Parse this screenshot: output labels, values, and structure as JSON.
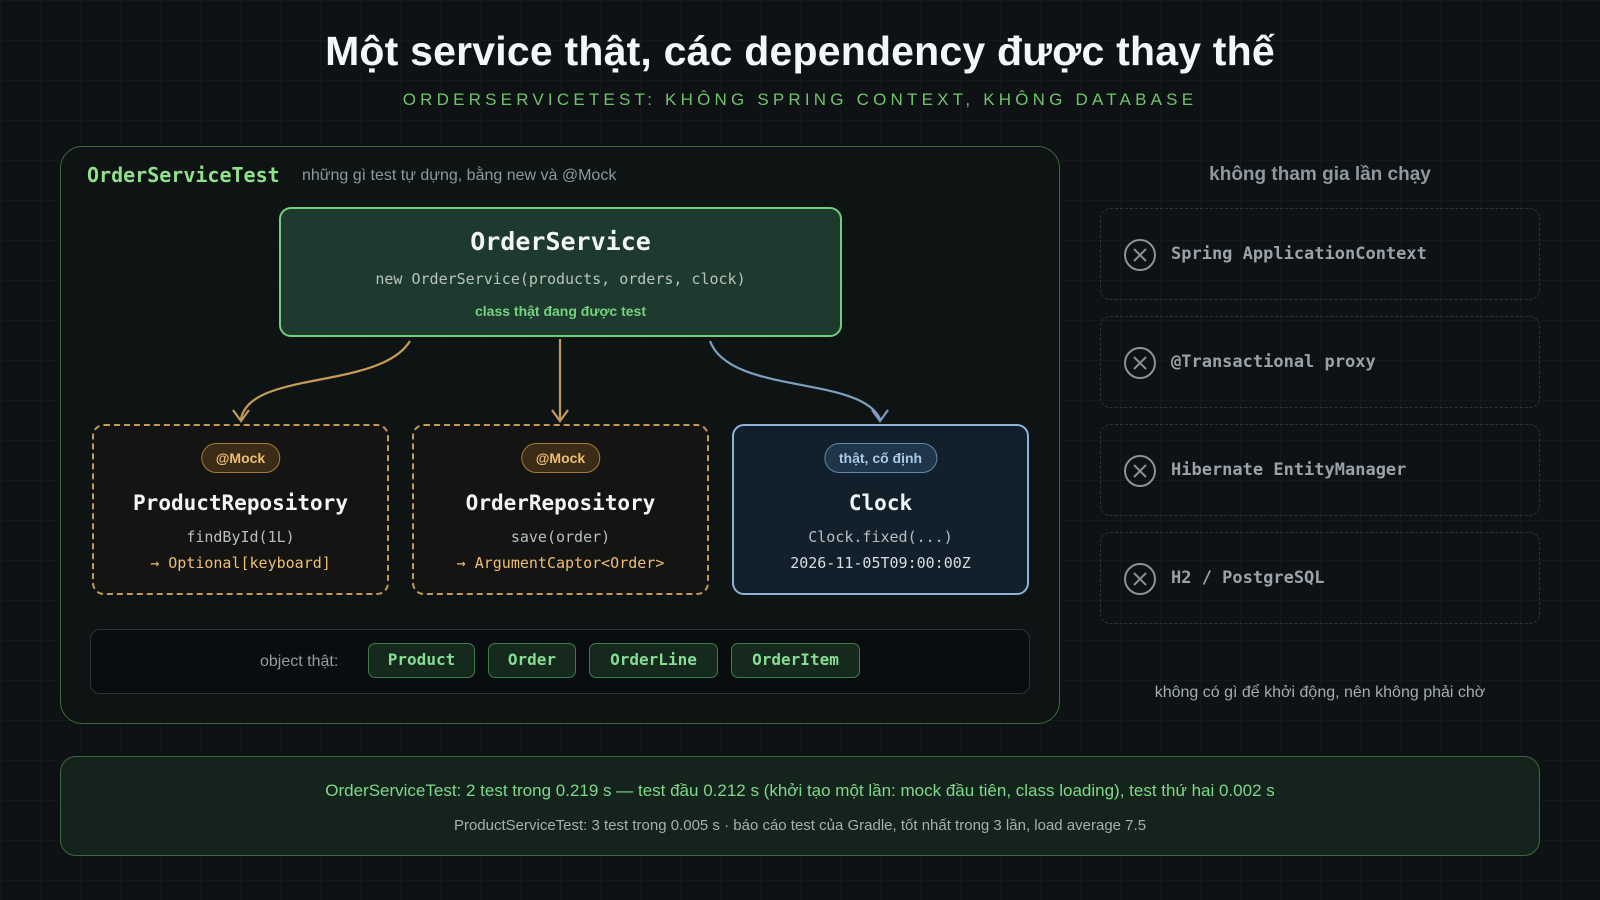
{
  "title": "Một service thật, các dependency được thay thế",
  "subtitle": "ORDERSERVICETEST: KHÔNG SPRING CONTEXT, KHÔNG DATABASE",
  "panel": {
    "name": "OrderServiceTest",
    "note": "những gì test tự dựng, bằng new và @Mock"
  },
  "service": {
    "name": "OrderService",
    "code": "new OrderService(products, orders, clock)",
    "tag": "class thật đang được test"
  },
  "dependencies": [
    {
      "badge": "@Mock",
      "name": "ProductRepository",
      "line1": "findById(1L)",
      "line2": "→ Optional[keyboard]",
      "kind": "mock"
    },
    {
      "badge": "@Mock",
      "name": "OrderRepository",
      "line1": "save(order)",
      "line2": "→ ArgumentCaptor<Order>",
      "kind": "mock"
    },
    {
      "badge": "thật, cố định",
      "name": "Clock",
      "line1": "Clock.fixed(...)",
      "line2": "2026-11-05T09:00:00Z",
      "kind": "real"
    }
  ],
  "real_objects": {
    "label": "object thật:",
    "items": [
      "Product",
      "Order",
      "OrderLine",
      "OrderItem"
    ]
  },
  "excluded": {
    "heading": "không tham gia lần chạy",
    "items": [
      "Spring ApplicationContext",
      "@Transactional proxy",
      "Hibernate EntityManager",
      "H2 / PostgreSQL"
    ],
    "footer": "không có gì để khởi động, nên không phải chờ"
  },
  "summary": {
    "line1": "OrderServiceTest: 2 test trong 0.219 s — test đầu 0.212 s (khởi tạo một lần: mock đầu tiên, class loading), test thứ hai 0.002 s",
    "line2": "ProductServiceTest: 3 test trong 0.005 s · báo cáo test của Gradle, tốt nhất trong 3 lần, load average 7.5"
  },
  "colors": {
    "accent_green": "#6fcf7d",
    "mock_orange": "#c59a56",
    "real_blue": "#8db4d6"
  }
}
